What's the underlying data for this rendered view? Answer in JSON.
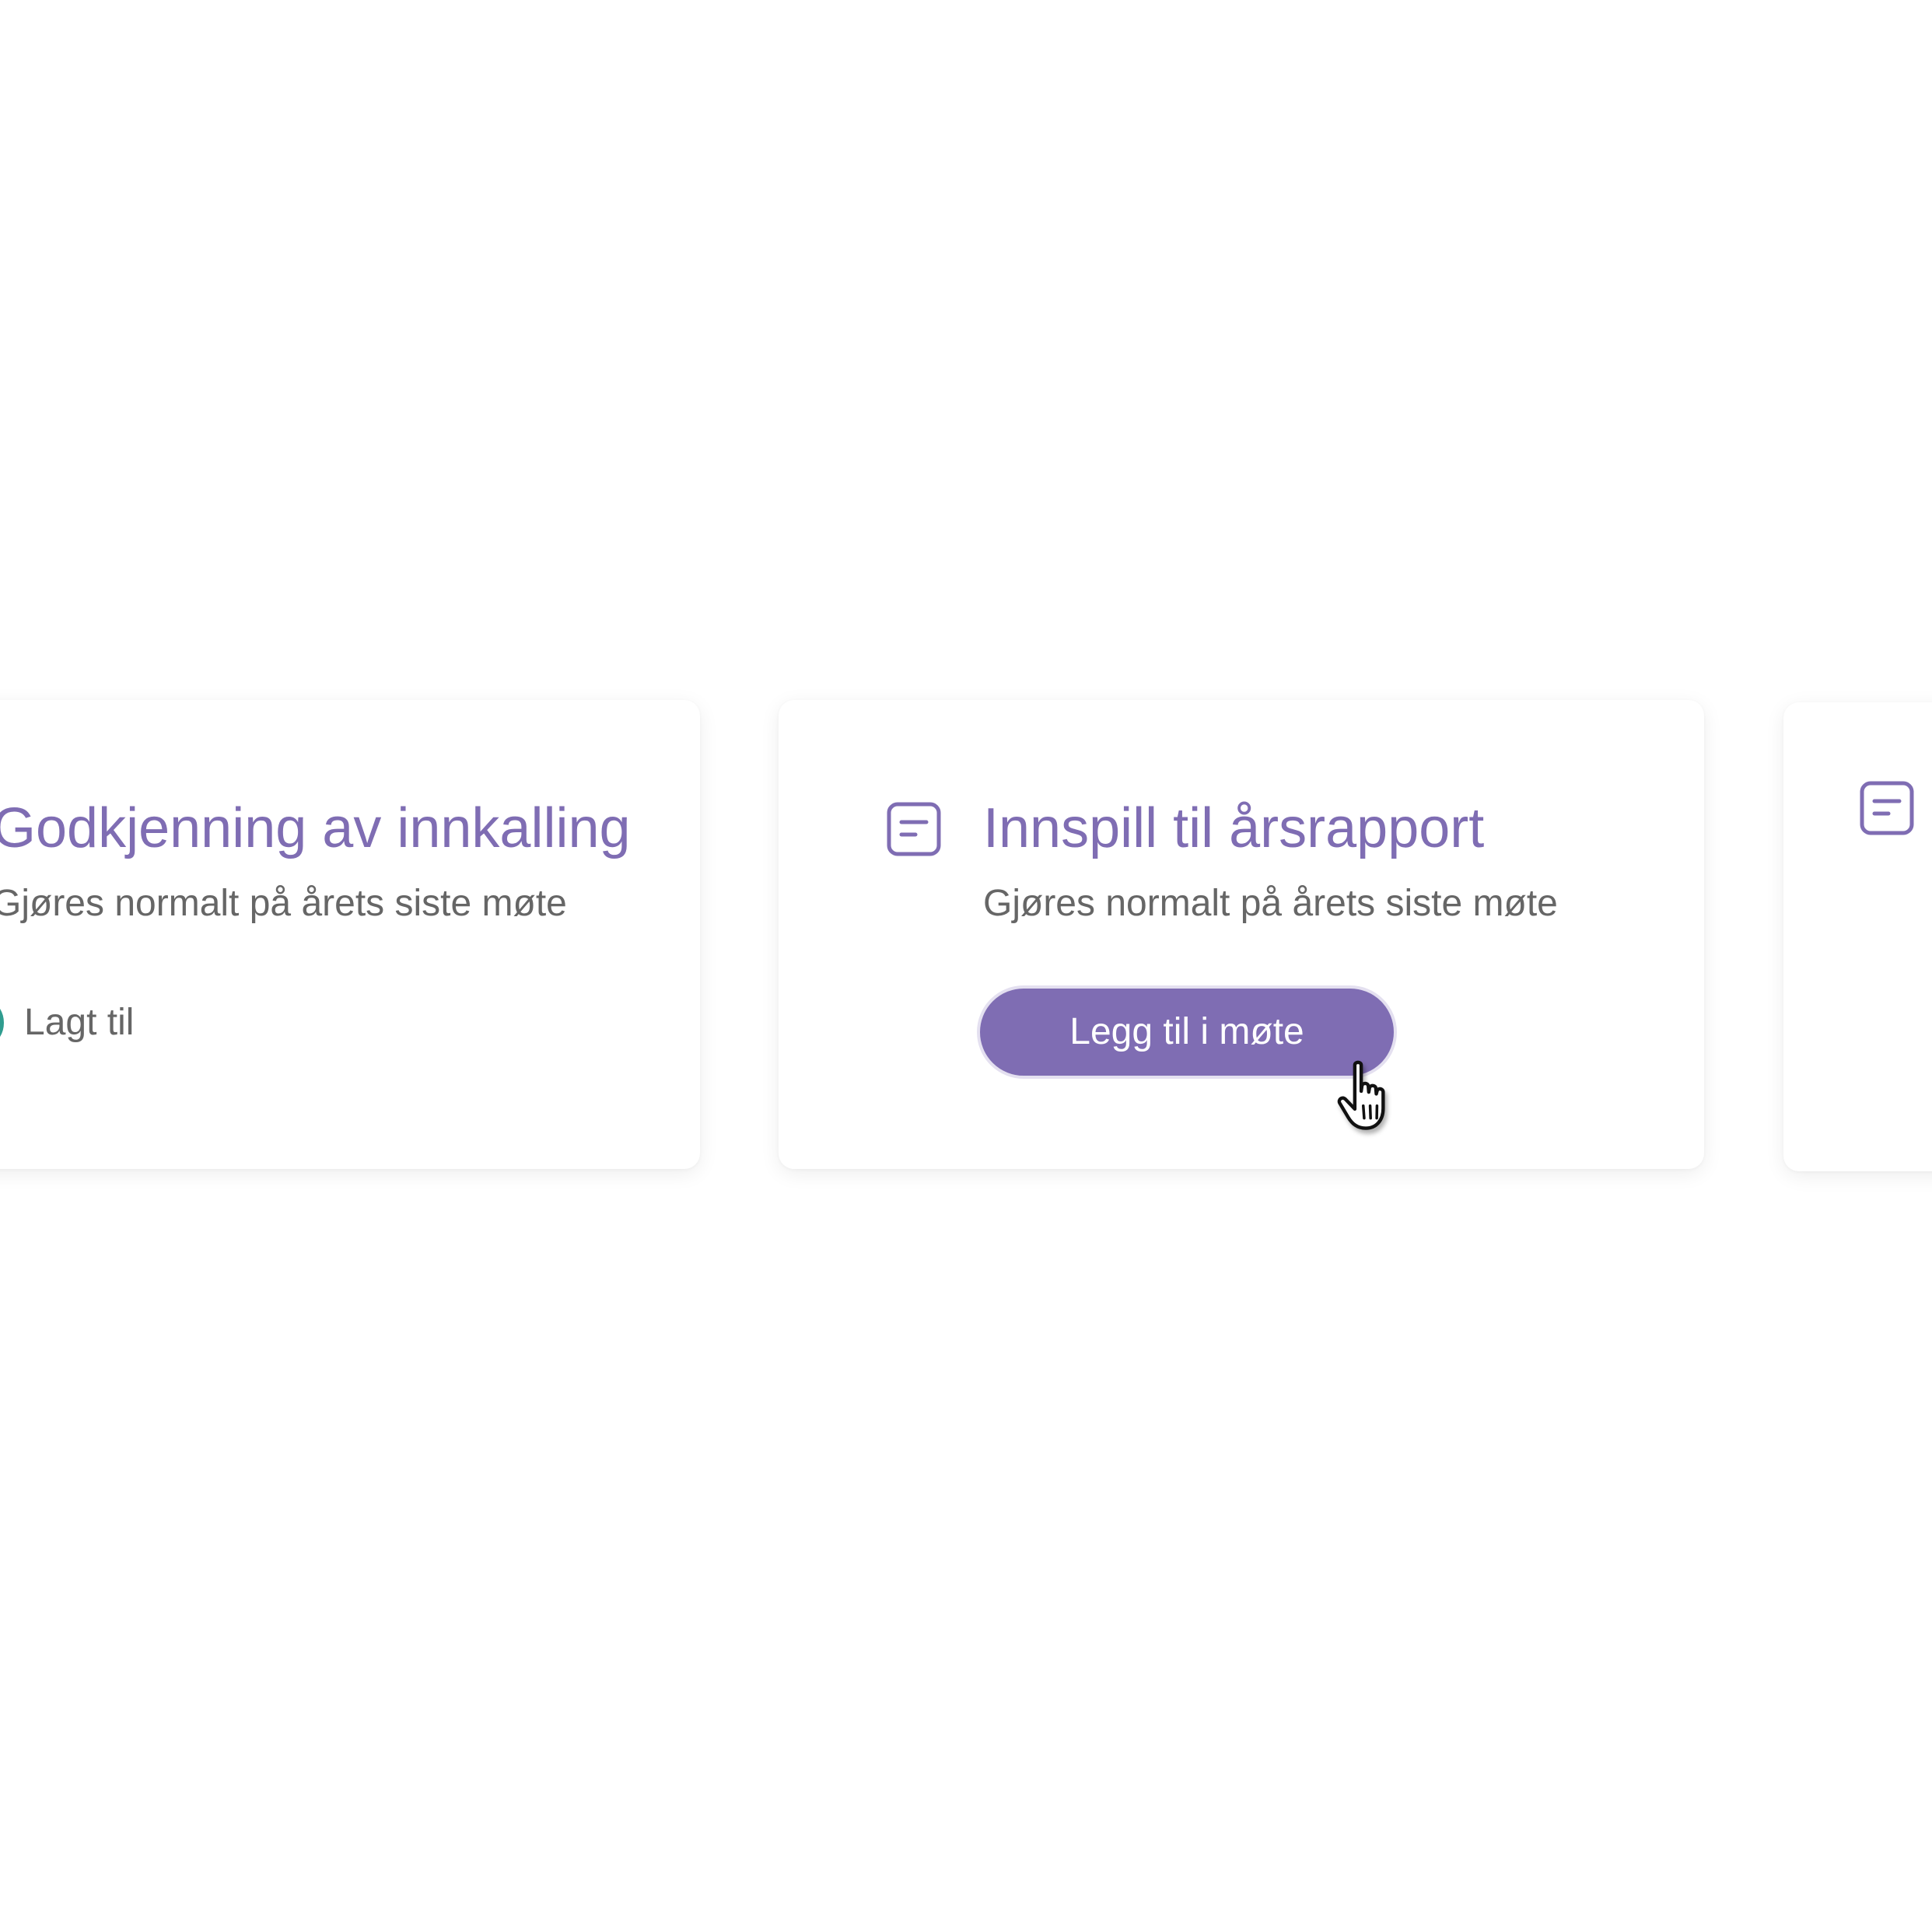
{
  "colors": {
    "accent": "#7f6db3",
    "text_muted": "#666666",
    "success": "#2f9c8f",
    "button_text": "#ffffff"
  },
  "cards": [
    {
      "title": "Godkjenning av innkalling",
      "subtitle": "Gjøres normalt på årets siste møte",
      "status": {
        "icon": "check-circle-icon",
        "label": "Lagt til"
      }
    },
    {
      "icon": "document-icon",
      "title": "Innspill til årsrapport",
      "subtitle": "Gjøres normalt på årets siste møte",
      "button": {
        "label": "Legg til i møte"
      }
    },
    {
      "icon": "document-icon"
    }
  ],
  "cursor": {
    "icon": "hand-pointer-icon"
  }
}
